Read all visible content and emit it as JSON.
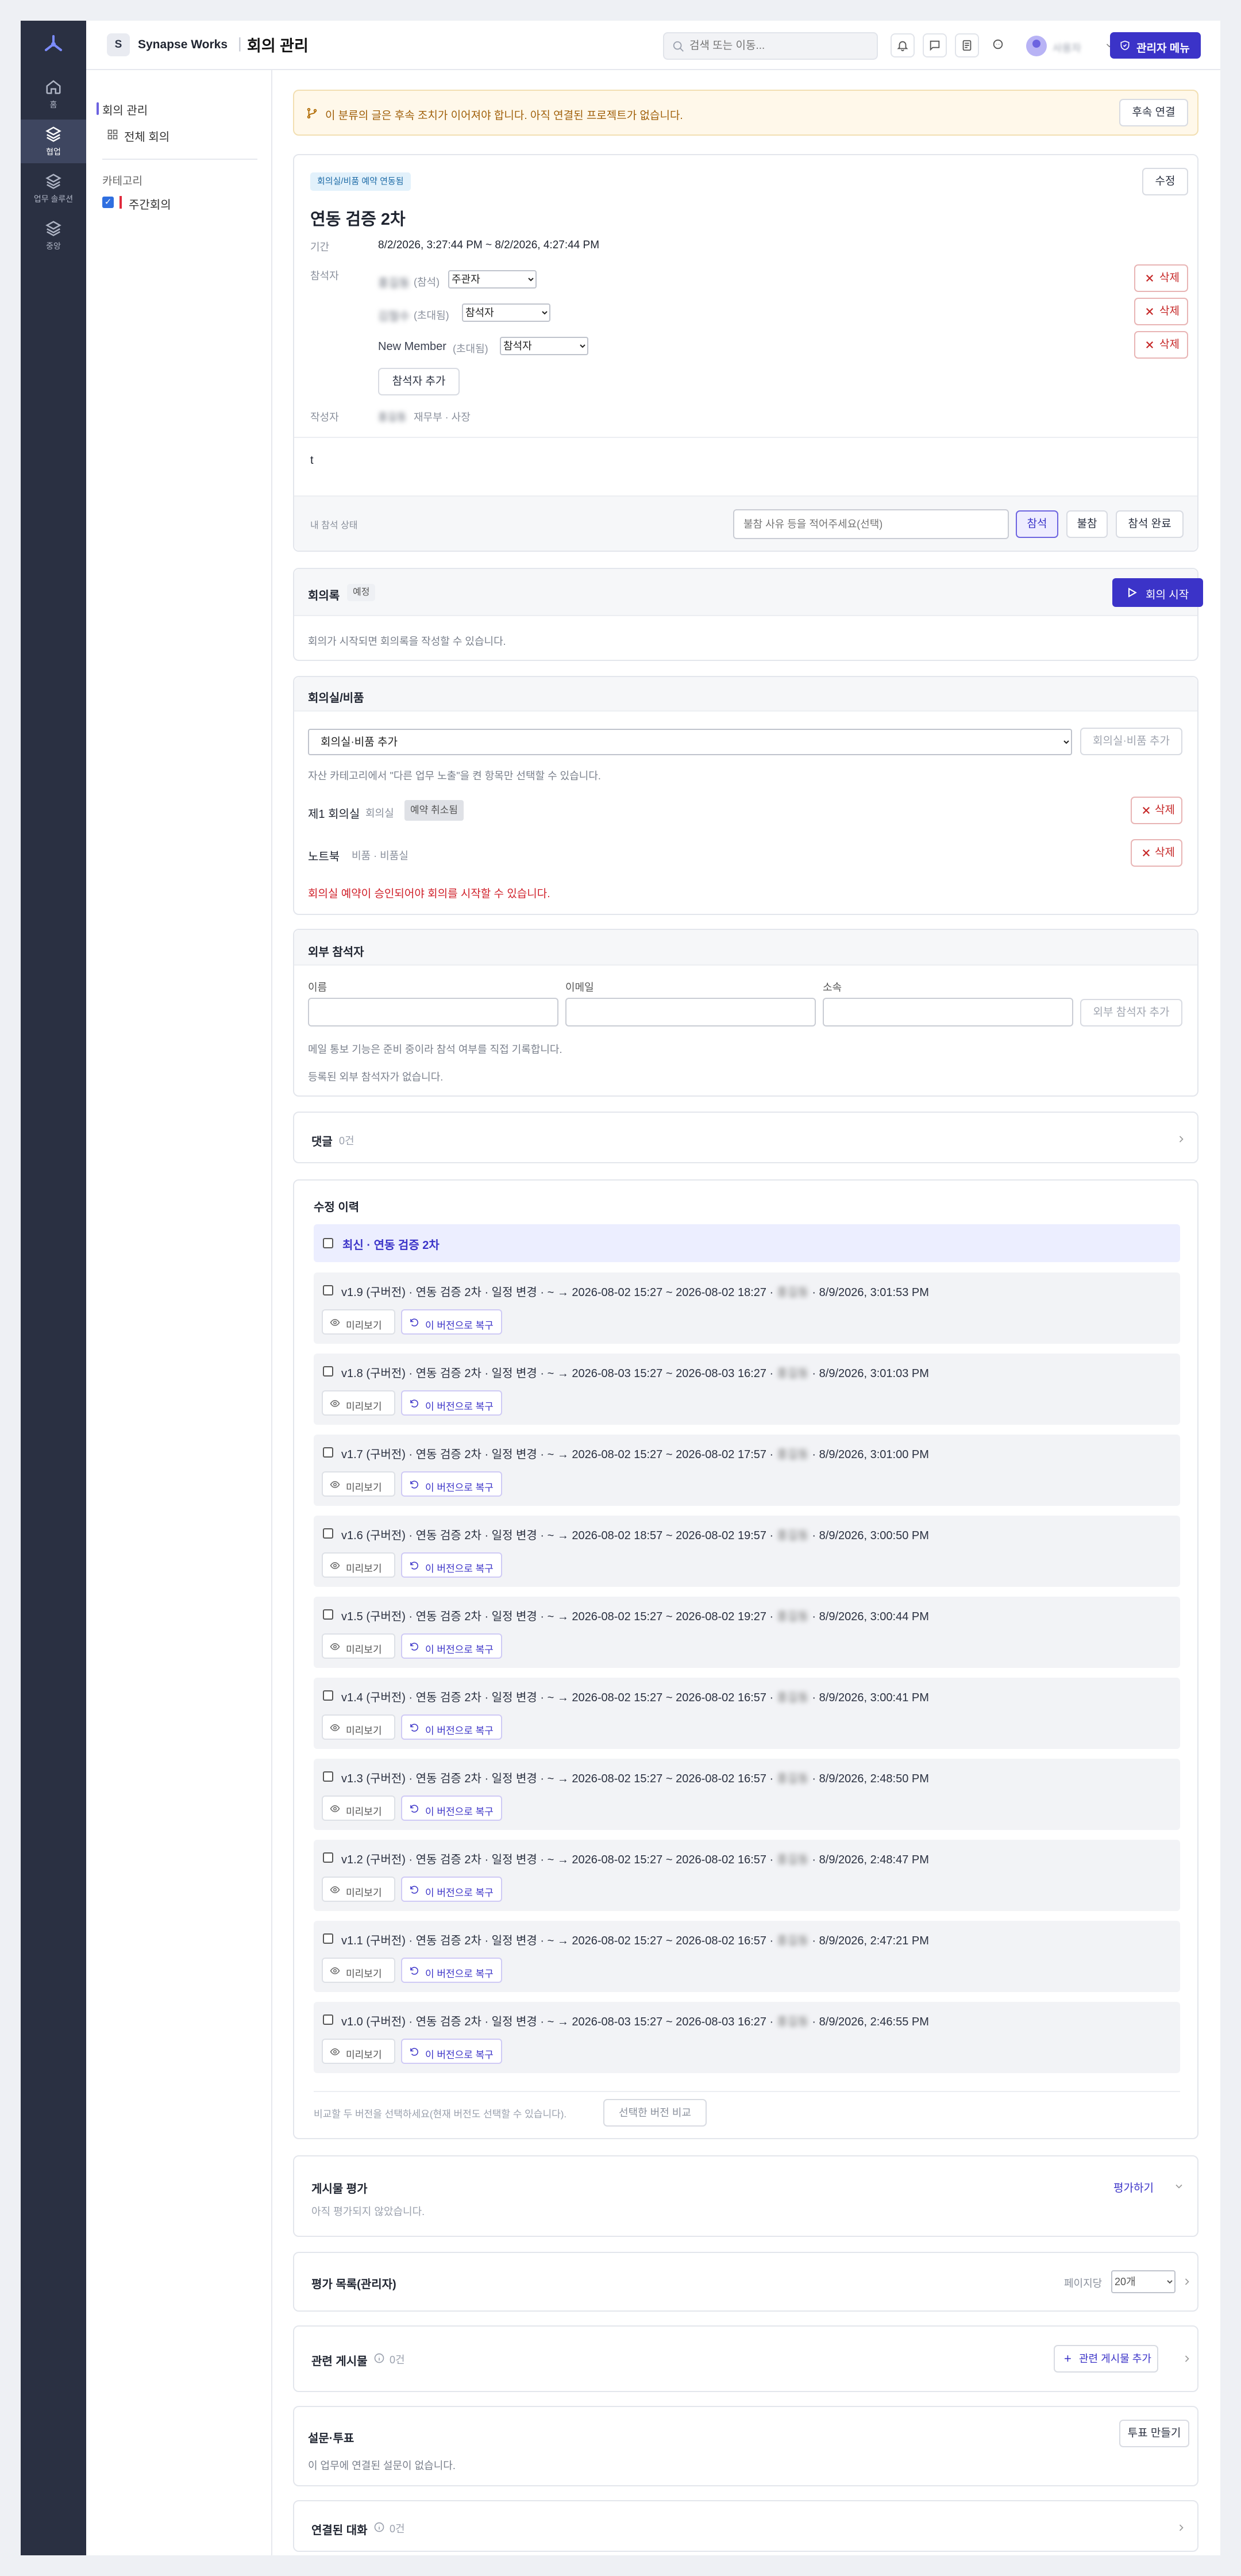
{
  "rail": {
    "items": [
      {
        "label": "홈",
        "icon": "home-icon"
      },
      {
        "label": "협업",
        "icon": "layers-icon",
        "active": true
      },
      {
        "label": "업무 솔루션",
        "icon": "layers-icon"
      },
      {
        "label": "중앙",
        "icon": "layers-icon"
      }
    ]
  },
  "topbar": {
    "workspace_badge": "S",
    "workspace_name": "Synapse Works",
    "page_title": "회의 관리",
    "search_placeholder": "검색 또는 이동...",
    "user_name": "사용자",
    "admin_menu": "관리자 메뉴"
  },
  "side": {
    "section_title": "회의 관리",
    "all_meetings": "전체 회의",
    "category_label": "카테고리",
    "category_item": "주간회의"
  },
  "banner": {
    "text": "이 분류의 글은 후속 조치가 이어져야 합니다. 아직 연결된 프로젝트가 없습니다.",
    "button": "후속 연결"
  },
  "meeting": {
    "tag": "회의실/비품 예약 연동됨",
    "edit": "수정",
    "title": "연동 검증 2차",
    "period_label": "기간",
    "period_value": "8/2/2026, 3:27:44 PM ~ 8/2/2026, 4:27:44 PM",
    "participants_label": "참석자",
    "participants": [
      {
        "name": "홍길동",
        "status": "(참석)",
        "role": "주관자"
      },
      {
        "name": "김철수",
        "status": "(초대됨)",
        "role": "참석자"
      },
      {
        "name": "New Member",
        "status": "(초대됨)",
        "role": "참석자"
      }
    ],
    "delete": "삭제",
    "add_participant": "참석자 추가",
    "author_label": "작성자",
    "author_name": "홍길동",
    "author_dept": "재무부 · 사장",
    "body": "t",
    "my_status_label": "내 참석 상태",
    "absence_placeholder": "불참 사유 등을 적어주세요(선택)",
    "attend": "참석",
    "absent": "불참",
    "attend_done": "참석 완료"
  },
  "minutes": {
    "title": "회의록",
    "badge": "예정",
    "start": "회의 시작",
    "hint": "회의가 시작되면 회의록을 작성할 수 있습니다."
  },
  "rooms": {
    "title": "회의실/비품",
    "select_value": "회의실·비품 추가",
    "add_button": "회의실·비품 추가",
    "hint": "자산 카테고리에서 \"다른 업무 노출\"을 켠 항목만 선택할 수 있습니다.",
    "items": [
      {
        "name": "제1 회의실",
        "type": "회의실",
        "badge": "예약 취소됨"
      },
      {
        "name": "노트북",
        "type": "비품 · 비품실",
        "badge": ""
      }
    ],
    "warning": "회의실 예약이 승인되어야 회의를 시작할 수 있습니다."
  },
  "external": {
    "title": "외부 참석자",
    "name_label": "이름",
    "email_label": "이메일",
    "org_label": "소속",
    "add_button": "외부 참석자 추가",
    "hint": "메일 통보 기능은 준비 중이라 참석 여부를 직접 기록합니다.",
    "empty": "등록된 외부 참석자가 없습니다."
  },
  "comments": {
    "title": "댓글",
    "count": "0건"
  },
  "history": {
    "title": "수정 이력",
    "latest": "최신 · 연동 검증 2차",
    "preview": "미리보기",
    "restore": "이 버전으로 복구",
    "items": [
      {
        "prefix": "v1.9 (구버전) · 연동 검증 2차 · 일정 변경 · ~ → 2026-08-02 15:27 ~ 2026-08-02 18:27 ·",
        "who": "홍길동",
        "when": "· 8/9/2026, 3:01:53 PM"
      },
      {
        "prefix": "v1.8 (구버전) · 연동 검증 2차 · 일정 변경 · ~ → 2026-08-03 15:27 ~ 2026-08-03 16:27 ·",
        "who": "홍길동",
        "when": "· 8/9/2026, 3:01:03 PM"
      },
      {
        "prefix": "v1.7 (구버전) · 연동 검증 2차 · 일정 변경 · ~ → 2026-08-02 15:27 ~ 2026-08-02 17:57 ·",
        "who": "홍길동",
        "when": "· 8/9/2026, 3:01:00 PM"
      },
      {
        "prefix": "v1.6 (구버전) · 연동 검증 2차 · 일정 변경 · ~ → 2026-08-02 18:57 ~ 2026-08-02 19:57 ·",
        "who": "홍길동",
        "when": "· 8/9/2026, 3:00:50 PM"
      },
      {
        "prefix": "v1.5 (구버전) · 연동 검증 2차 · 일정 변경 · ~ → 2026-08-02 15:27 ~ 2026-08-02 19:27 ·",
        "who": "홍길동",
        "when": "· 8/9/2026, 3:00:44 PM"
      },
      {
        "prefix": "v1.4 (구버전) · 연동 검증 2차 · 일정 변경 · ~ → 2026-08-02 15:27 ~ 2026-08-02 16:57 ·",
        "who": "홍길동",
        "when": "· 8/9/2026, 3:00:41 PM"
      },
      {
        "prefix": "v1.3 (구버전) · 연동 검증 2차 · 일정 변경 · ~ → 2026-08-02 15:27 ~ 2026-08-02 16:57 ·",
        "who": "홍길동",
        "when": "· 8/9/2026, 2:48:50 PM"
      },
      {
        "prefix": "v1.2 (구버전) · 연동 검증 2차 · 일정 변경 · ~ → 2026-08-02 15:27 ~ 2026-08-02 16:57 ·",
        "who": "홍길동",
        "when": "· 8/9/2026, 2:48:47 PM"
      },
      {
        "prefix": "v1.1 (구버전) · 연동 검증 2차 · 일정 변경 · ~ → 2026-08-02 15:27 ~ 2026-08-02 16:57 ·",
        "who": "홍길동",
        "when": "· 8/9/2026, 2:47:21 PM"
      },
      {
        "prefix": "v1.0 (구버전) · 연동 검증 2차 · 일정 변경 · ~ → 2026-08-03 15:27 ~ 2026-08-03 16:27 ·",
        "who": "홍길동",
        "when": "· 8/9/2026, 2:46:55 PM"
      }
    ],
    "compare_hint": "비교할 두 버전을 선택하세요(현재 버전도 선택할 수 있습니다).",
    "compare_button": "선택한 버전 비교"
  },
  "rating": {
    "title": "게시물 평가",
    "action": "평가하기",
    "empty": "아직 평가되지 않았습니다."
  },
  "rating_list": {
    "title": "평가 목록(관리자)",
    "per_page_label": "페이지당",
    "per_page_value": "20개"
  },
  "related": {
    "title": "관련 게시물",
    "count": "0건",
    "add": "관련 게시물 추가"
  },
  "survey": {
    "title": "설문·투표",
    "create": "투표 만들기",
    "empty": "이 업무에 연결된 설문이 없습니다."
  },
  "chat": {
    "title": "연결된 대화",
    "count": "0건"
  }
}
